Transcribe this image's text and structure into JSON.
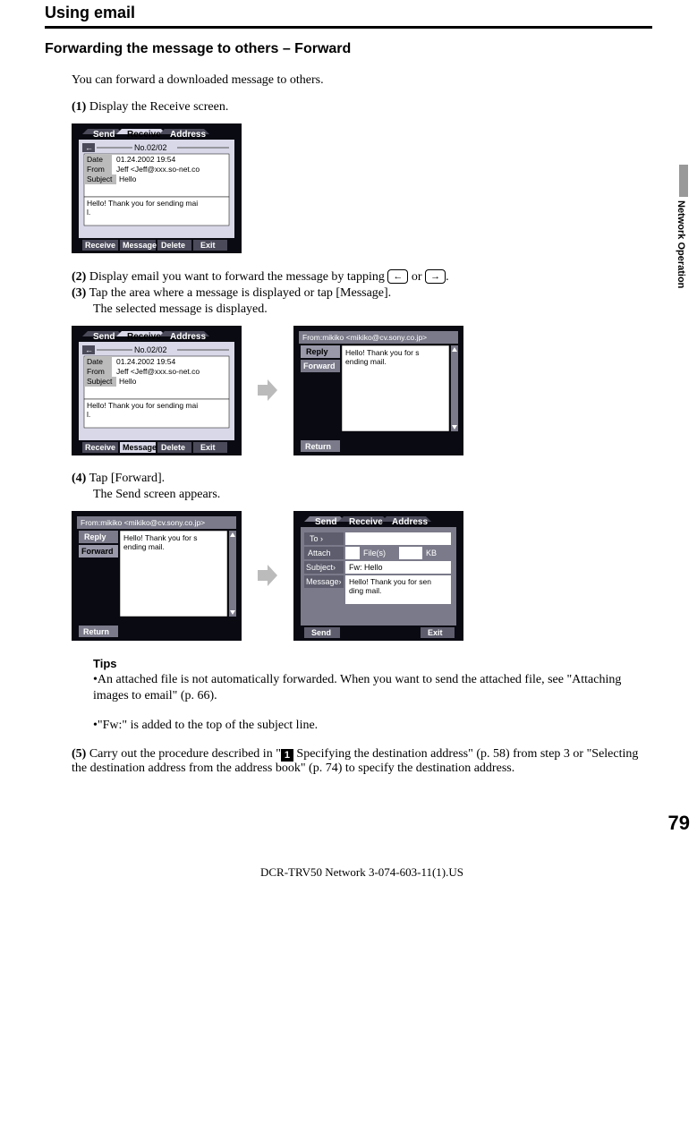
{
  "header": "Using email",
  "section": "Forwarding the message to others – Forward",
  "intro": "You can forward a downloaded message to others.",
  "steps": {
    "s1_label": "(1)",
    "s1_text": "Display the Receive screen.",
    "s2_label": "(2)",
    "s2_text_a": "Display email you want to forward the message by tapping ",
    "s2_text_b": " or ",
    "s2_text_c": ".",
    "s3_label": "(3)",
    "s3_text_a": "Tap the area where a message is displayed or tap [Message].",
    "s3_text_b": "The selected message is displayed.",
    "s4_label": "(4)",
    "s4_text_a": "Tap [Forward].",
    "s4_text_b": "The Send screen appears.",
    "s5_label": "(5)",
    "s5_text_a": "Carry out the procedure described in \"",
    "s5_text_b": " Specifying the destination address\" (p. 58) from step 3 or \"Selecting the destination address from the address book\" (p. 74) to specify the destination address."
  },
  "tips": {
    "heading": "Tips",
    "t1": "•An attached file is not automatically forwarded. When you want to send the attached file, see \"Attaching images to email\" (p. 66).",
    "t2": "•\"Fw:\" is added to the top of the subject line."
  },
  "icons": {
    "prev": "←",
    "next": "→",
    "stepnum": "1"
  },
  "side_label": "Network Operation",
  "page_number": "79",
  "footer": "DCR-TRV50 Network 3-074-603-11(1).US",
  "shots": {
    "receive": {
      "tabs": {
        "send": "Send",
        "receive": "Receive",
        "address": "Address"
      },
      "header": "No.02/02",
      "date_lbl": "Date",
      "date": "01.24.2002 19:54",
      "from_lbl": "From",
      "from": "Jeff <Jeff@xxx.so-net.co",
      "subj_lbl": "Subject",
      "subj": "Hello",
      "body": "Hello! Thank you for sending mail.",
      "buttons": {
        "receive": "Receive",
        "message": "Message",
        "delete": "Delete",
        "exit": "Exit"
      }
    },
    "msgview": {
      "title": "From:mikiko <mikiko@cv.sony.co.jp>",
      "reply": "Reply",
      "forward": "Forward",
      "return": "Return",
      "body": "Hello! Thank you for sending mail."
    },
    "compose": {
      "tabs": {
        "send": "Send",
        "receive": "Receive",
        "address": "Address"
      },
      "to": "To  ›",
      "attach": "Attach",
      "files": "File(s)",
      "kb": "KB",
      "subj": "Subject›",
      "subj_val": "Fw: Hello",
      "msg": "Message›",
      "msg_val": "Hello! Thank you for sending mail.",
      "send": "Send",
      "exit": "Exit"
    }
  }
}
